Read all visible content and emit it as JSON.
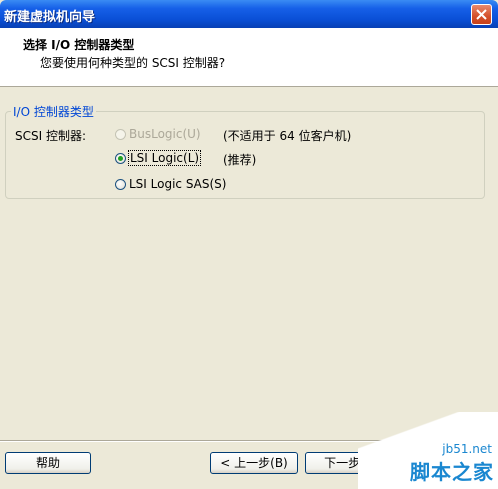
{
  "window": {
    "title": "新建虚拟机向导"
  },
  "header": {
    "title": "选择 I/O 控制器类型",
    "subtitle": "您要使用何种类型的 SCSI 控制器?"
  },
  "group": {
    "legend": "I/O 控制器类型",
    "field_label": "SCSI 控制器:",
    "options": [
      {
        "label": "BusLogic(U)",
        "note": "(不适用于 64 位客户机)",
        "selected": false,
        "disabled": true
      },
      {
        "label": "LSI Logic(L)",
        "note": "(推荐)",
        "selected": true,
        "disabled": false
      },
      {
        "label": "LSI Logic SAS(S)",
        "note": "",
        "selected": false,
        "disabled": false
      }
    ]
  },
  "buttons": {
    "help": "帮助",
    "back": "< 上一步(B)",
    "next": "下一步(N"
  },
  "watermark": {
    "url": "jb51.net",
    "name": "脚本之家"
  }
}
